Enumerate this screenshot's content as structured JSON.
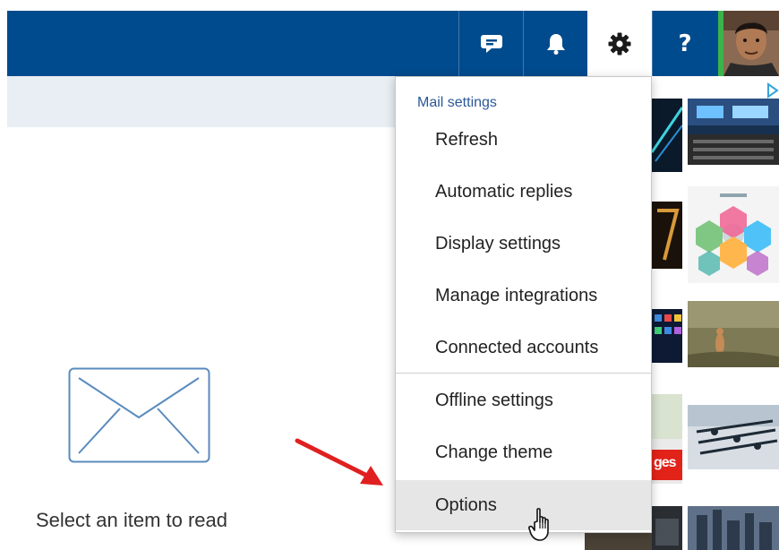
{
  "topbar": {
    "chat_icon": "chat-bubble-icon",
    "bell_icon": "bell-icon",
    "gear_icon": "gear-icon",
    "help_label": "?",
    "avatar": "user-avatar"
  },
  "reading_pane": {
    "empty_icon": "envelope-icon",
    "empty_text": "Select an item to read"
  },
  "settings_menu": {
    "header": "Mail settings",
    "items": [
      {
        "label": "Refresh"
      },
      {
        "label": "Automatic replies"
      },
      {
        "label": "Display settings"
      },
      {
        "label": "Manage integrations"
      },
      {
        "label": "Connected accounts"
      },
      {
        "label": "Offline settings"
      },
      {
        "label": "Change theme"
      },
      {
        "label": "Options"
      }
    ],
    "hovered_item": "Options"
  },
  "ads": {
    "badge_icon": "ad-choices-icon",
    "tile_text": "ges"
  },
  "colors": {
    "topbar": "#004b8d",
    "subbar": "#e8eef3",
    "menu_header": "#2b5797",
    "hover": "#e6e6e6",
    "arrow": "#e02020"
  }
}
